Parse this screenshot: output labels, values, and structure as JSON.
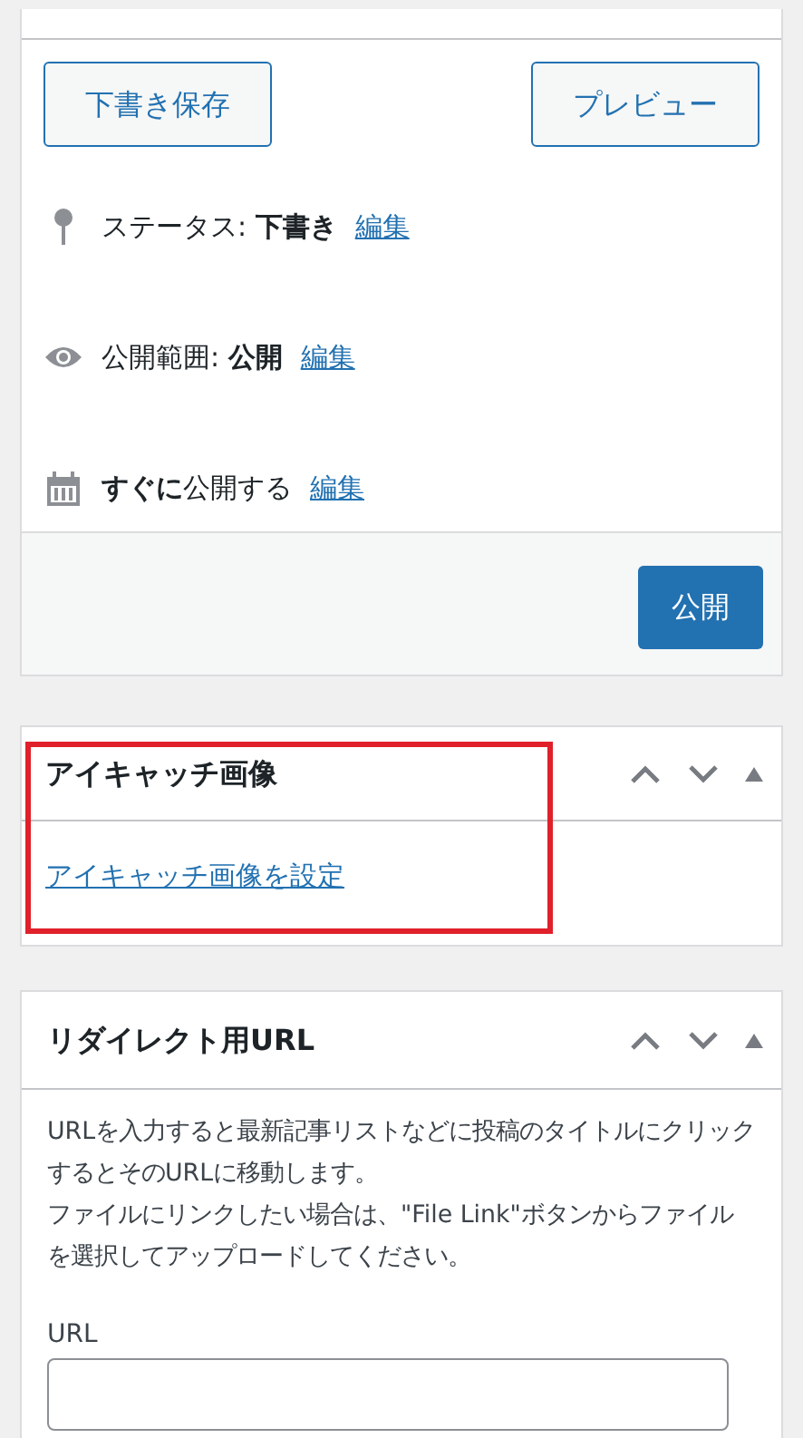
{
  "publish_box": {
    "buttons": [
      "下書き保存",
      "プレビュー"
    ],
    "rows": [
      {
        "kind": "status",
        "label": "ステータス:",
        "value": "下書き",
        "link": "編集"
      },
      {
        "kind": "visibility",
        "label": "公開範囲:",
        "value": "公開",
        "link": "編集"
      },
      {
        "kind": "schedule",
        "label": "すぐに",
        "value": "公開する",
        "link": "編集"
      }
    ],
    "publish_button": "公開"
  },
  "featured_image": {
    "title": "アイキャッチ画像",
    "link": "アイキャッチ画像を設定",
    "highlighted": true
  },
  "redirect_box": {
    "title": "リダイレクト用URL",
    "paragraphs": [
      "URLを入力すると最新記事リストなどに投稿のタイトルにクリックするとそのURLに移動します。",
      "ファイルにリンクしたい場合は、\"File Link\"ボタンからファイルを選択してアップロードしてください。"
    ],
    "field_label": "URL"
  }
}
